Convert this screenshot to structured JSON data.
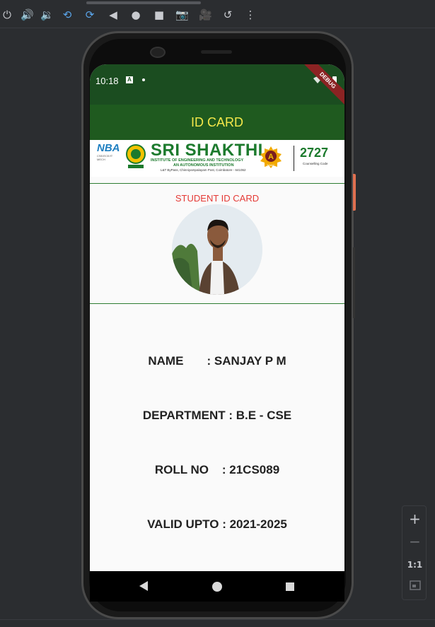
{
  "toolbar": {
    "icons": [
      "power-icon",
      "volume-up-icon",
      "volume-down-icon",
      "rotate-left-icon",
      "rotate-right-icon",
      "back-icon",
      "home-icon",
      "overview-icon",
      "camera-icon",
      "video-icon",
      "replay-icon",
      "more-icon"
    ]
  },
  "status_bar": {
    "time": "10:18",
    "notification_letter": "A",
    "debug_label": "DEBUG"
  },
  "app_bar": {
    "title": "ID CARD",
    "background": "#1f5a1f",
    "title_color": "#f5e84a"
  },
  "banner": {
    "nba_text": "NBA",
    "nba_sub": "CSE/ECE/IT MECH",
    "college_name": "SRI SHAKTHI",
    "subtitle_1": "INSTITUTE OF ENGINEERING AND TECHNOLOGY",
    "subtitle_2": "AN AUTONOMOUS INSTITUTION",
    "address": "L&T ByPass, Chinniyampalayam Post, Coimbatore - 641062",
    "naac_grade": "A",
    "naac_label": "NAAC",
    "counselling_code": "2727",
    "counselling_label": "Counselling Code"
  },
  "card": {
    "heading": "STUDENT ID CARD",
    "heading_color": "#e53935",
    "name_line": "NAME       : SANJAY P M",
    "department_line": "DEPARTMENT : B.E - CSE",
    "roll_line": "ROLL NO    : 21CS089",
    "valid_line": "VALID UPTO : 2021-2025"
  },
  "zoom_controls": {
    "zoom_in": "+",
    "zoom_out": "−",
    "actual_size": "1:1"
  }
}
